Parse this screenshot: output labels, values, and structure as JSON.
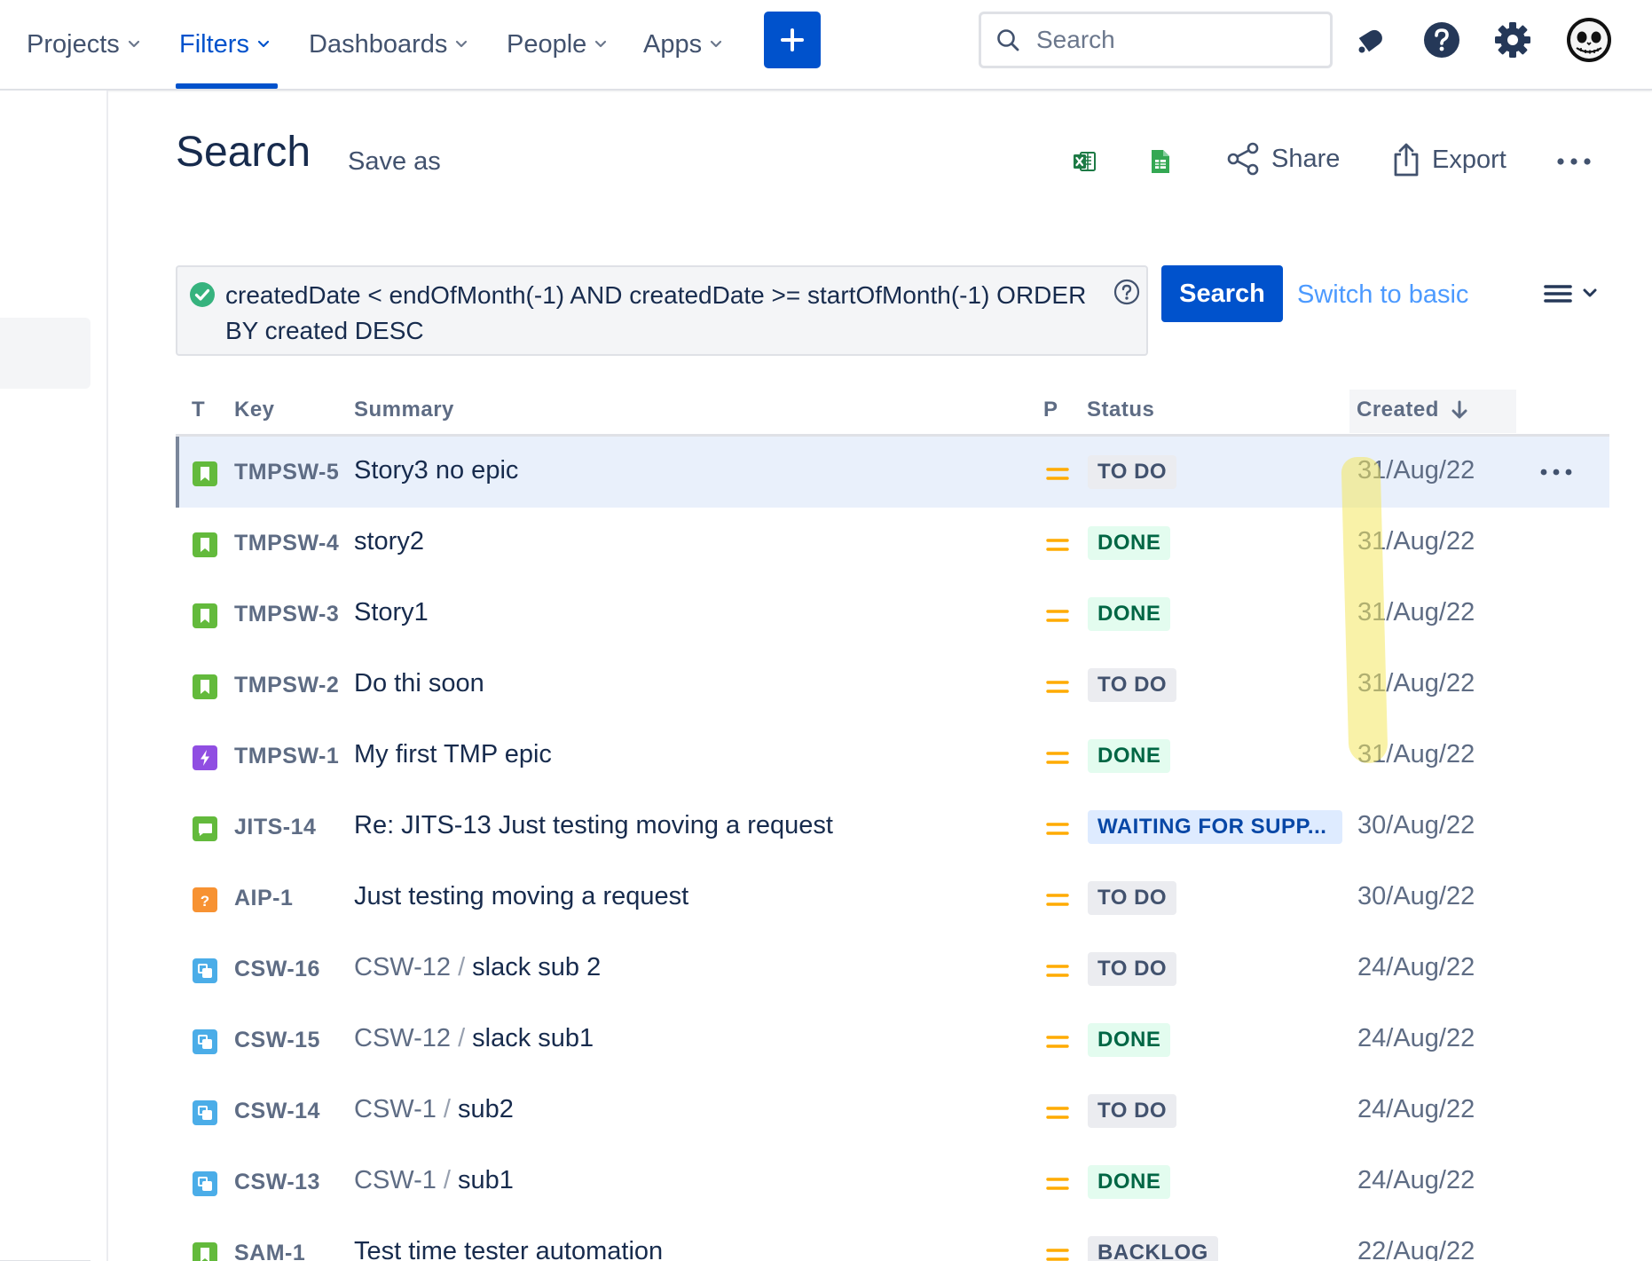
{
  "nav": {
    "items": [
      {
        "label": "Projects"
      },
      {
        "label": "Filters"
      },
      {
        "label": "Dashboards"
      },
      {
        "label": "People"
      },
      {
        "label": "Apps"
      }
    ],
    "search_placeholder": "Search"
  },
  "header": {
    "title": "Search",
    "save_as": "Save as",
    "share": "Share",
    "export": "Export"
  },
  "jql": {
    "query": "createdDate < endOfMonth(-1) AND createdDate >= startOfMonth(-1) ORDER BY created DESC",
    "search_button": "Search",
    "switch_label": "Switch to basic"
  },
  "table": {
    "columns": {
      "type": "T",
      "key": "Key",
      "summary": "Summary",
      "priority": "P",
      "status": "Status",
      "created": "Created"
    },
    "rows": [
      {
        "type": "story",
        "key": "TMPSW-5",
        "parent": "",
        "summary": "Story3 no epic",
        "status": "TO DO",
        "status_kind": "todo",
        "created": "31/Aug/22"
      },
      {
        "type": "story",
        "key": "TMPSW-4",
        "parent": "",
        "summary": "story2",
        "status": "DONE",
        "status_kind": "done",
        "created": "31/Aug/22"
      },
      {
        "type": "story",
        "key": "TMPSW-3",
        "parent": "",
        "summary": "Story1",
        "status": "DONE",
        "status_kind": "done",
        "created": "31/Aug/22"
      },
      {
        "type": "story",
        "key": "TMPSW-2",
        "parent": "",
        "summary": "Do thi soon",
        "status": "TO DO",
        "status_kind": "todo",
        "created": "31/Aug/22"
      },
      {
        "type": "epic",
        "key": "TMPSW-1",
        "parent": "",
        "summary": "My first TMP epic",
        "status": "DONE",
        "status_kind": "done",
        "created": "31/Aug/22"
      },
      {
        "type": "request",
        "key": "JITS-14",
        "parent": "",
        "summary": "Re: JITS-13 Just testing moving a request",
        "status": "WAITING FOR SUPP...",
        "status_kind": "wait",
        "created": "30/Aug/22"
      },
      {
        "type": "question",
        "key": "AIP-1",
        "parent": "",
        "summary": "Just testing moving a request",
        "status": "TO DO",
        "status_kind": "todo",
        "created": "30/Aug/22"
      },
      {
        "type": "subtask",
        "key": "CSW-16",
        "parent": "CSW-12",
        "summary": "slack sub 2",
        "status": "TO DO",
        "status_kind": "todo",
        "created": "24/Aug/22"
      },
      {
        "type": "subtask",
        "key": "CSW-15",
        "parent": "CSW-12",
        "summary": "slack sub1",
        "status": "DONE",
        "status_kind": "done",
        "created": "24/Aug/22"
      },
      {
        "type": "subtask",
        "key": "CSW-14",
        "parent": "CSW-1",
        "summary": "sub2",
        "status": "TO DO",
        "status_kind": "todo",
        "created": "24/Aug/22"
      },
      {
        "type": "subtask",
        "key": "CSW-13",
        "parent": "CSW-1",
        "summary": "sub1",
        "status": "DONE",
        "status_kind": "done",
        "created": "24/Aug/22"
      },
      {
        "type": "story",
        "key": "SAM-1",
        "parent": "",
        "summary": "Test time tester automation",
        "status": "BACKLOG",
        "status_kind": "todo",
        "created": "22/Aug/22"
      }
    ]
  },
  "colors": {
    "brand": "#0052cc",
    "story": "#63ba3c",
    "epic": "#904ee2",
    "subtask": "#4bade8",
    "question": "#f79232",
    "priority_medium": "#ffab00",
    "highlight": "#f4e860"
  },
  "icons": {
    "nav_chevron": "chevron-down-icon",
    "create": "plus-icon",
    "search": "search-icon",
    "notifications": "bell-icon",
    "help": "help-icon",
    "settings": "gear-icon",
    "profile": "avatar",
    "excel": "excel-icon",
    "sheets": "google-sheets-icon",
    "share": "share-icon",
    "export": "export-icon",
    "valid": "check-circle-icon",
    "syntax_help": "question-circle-icon",
    "sort": "arrow-down-icon"
  }
}
